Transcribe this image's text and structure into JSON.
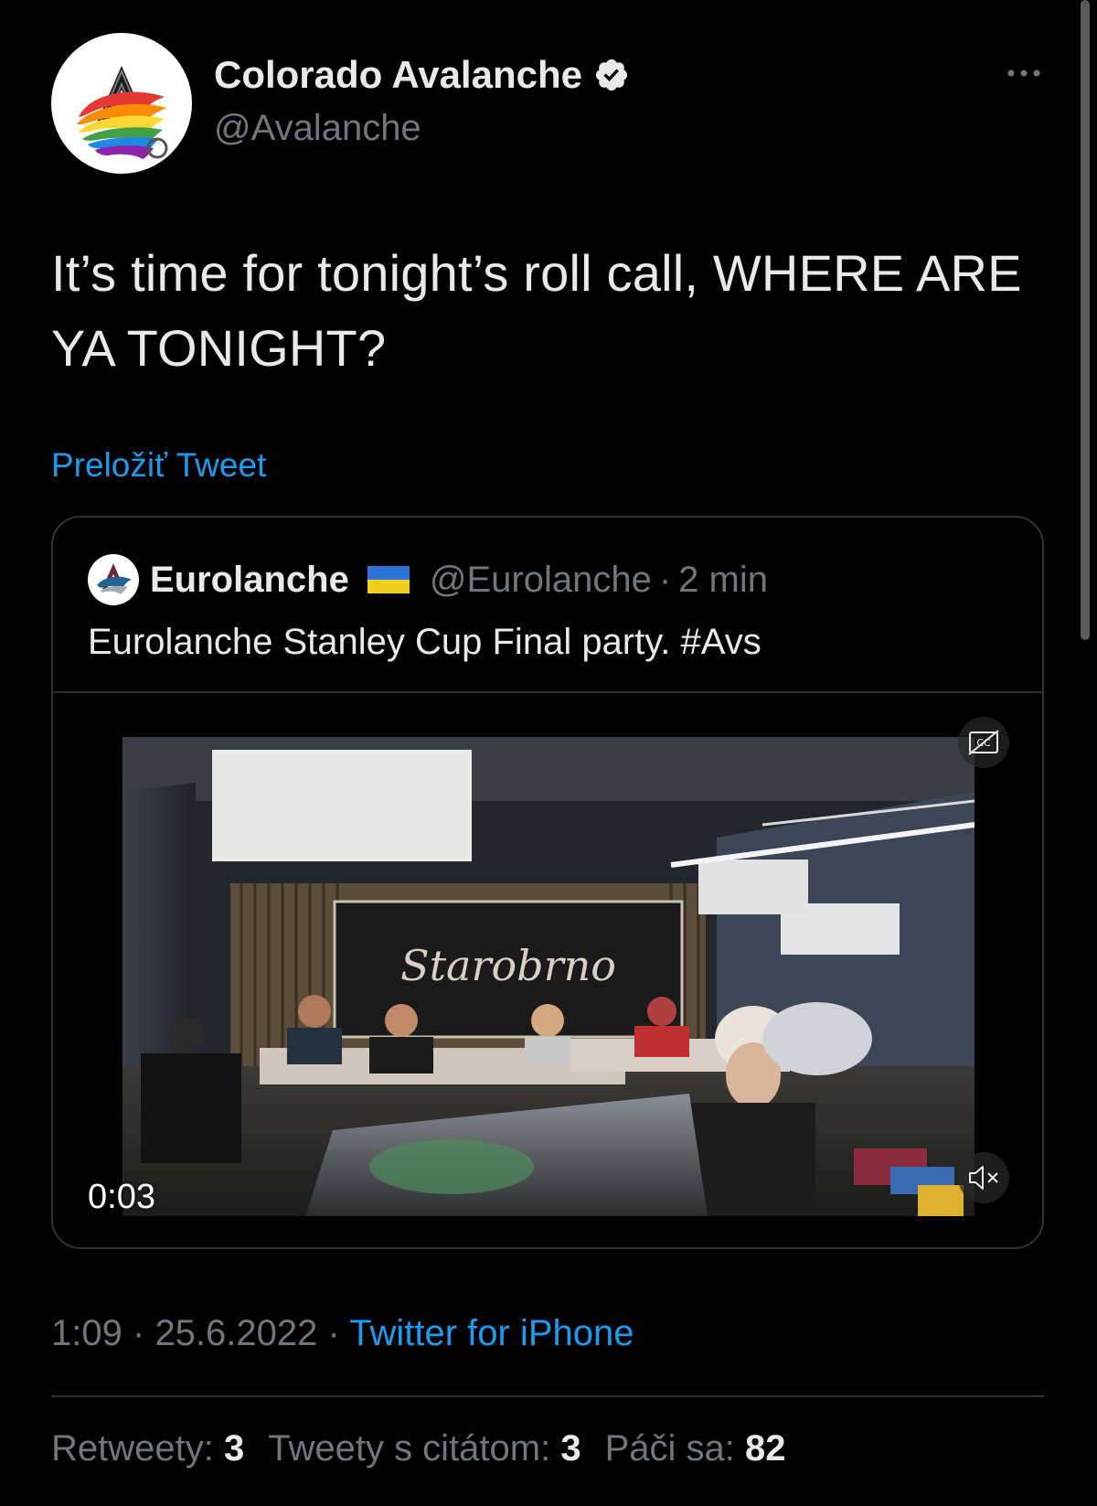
{
  "tweet": {
    "author": {
      "display_name": "Colorado Avalanche",
      "handle": "@Avalanche",
      "verified_icon": "verified-badge-icon"
    },
    "text": "It’s time for tonight’s roll call, WHERE ARE YA TONIGHT?",
    "translate_label": "Preložiť Tweet",
    "quoted": {
      "display_name": "Eurolanche",
      "flag_icon": "ukraine-flag-icon",
      "handle": "@Eurolanche",
      "separator": "·",
      "time_ago": "2 min",
      "text": "Eurolanche Stanley Cup Final party. #Avs",
      "video": {
        "elapsed": "0:03",
        "sign_text": "Starobrno",
        "cc_icon": "closed-captions-icon",
        "mute_icon": "volume-muted-icon"
      }
    },
    "meta": {
      "time": "1:09",
      "sep1": "·",
      "date": "25.6.2022",
      "sep2": "·",
      "source": "Twitter for iPhone"
    },
    "stats": {
      "retweets_label": "Retweety:",
      "retweets_count": "3",
      "quotes_label": "Tweety s citátom:",
      "quotes_count": "3",
      "likes_label": "Páči sa:",
      "likes_count": "82"
    }
  },
  "colors": {
    "background": "#000000",
    "primary_text": "#e7e9ea",
    "secondary_text": "#71767b",
    "link": "#1d9bf0",
    "border": "#2f3336"
  }
}
